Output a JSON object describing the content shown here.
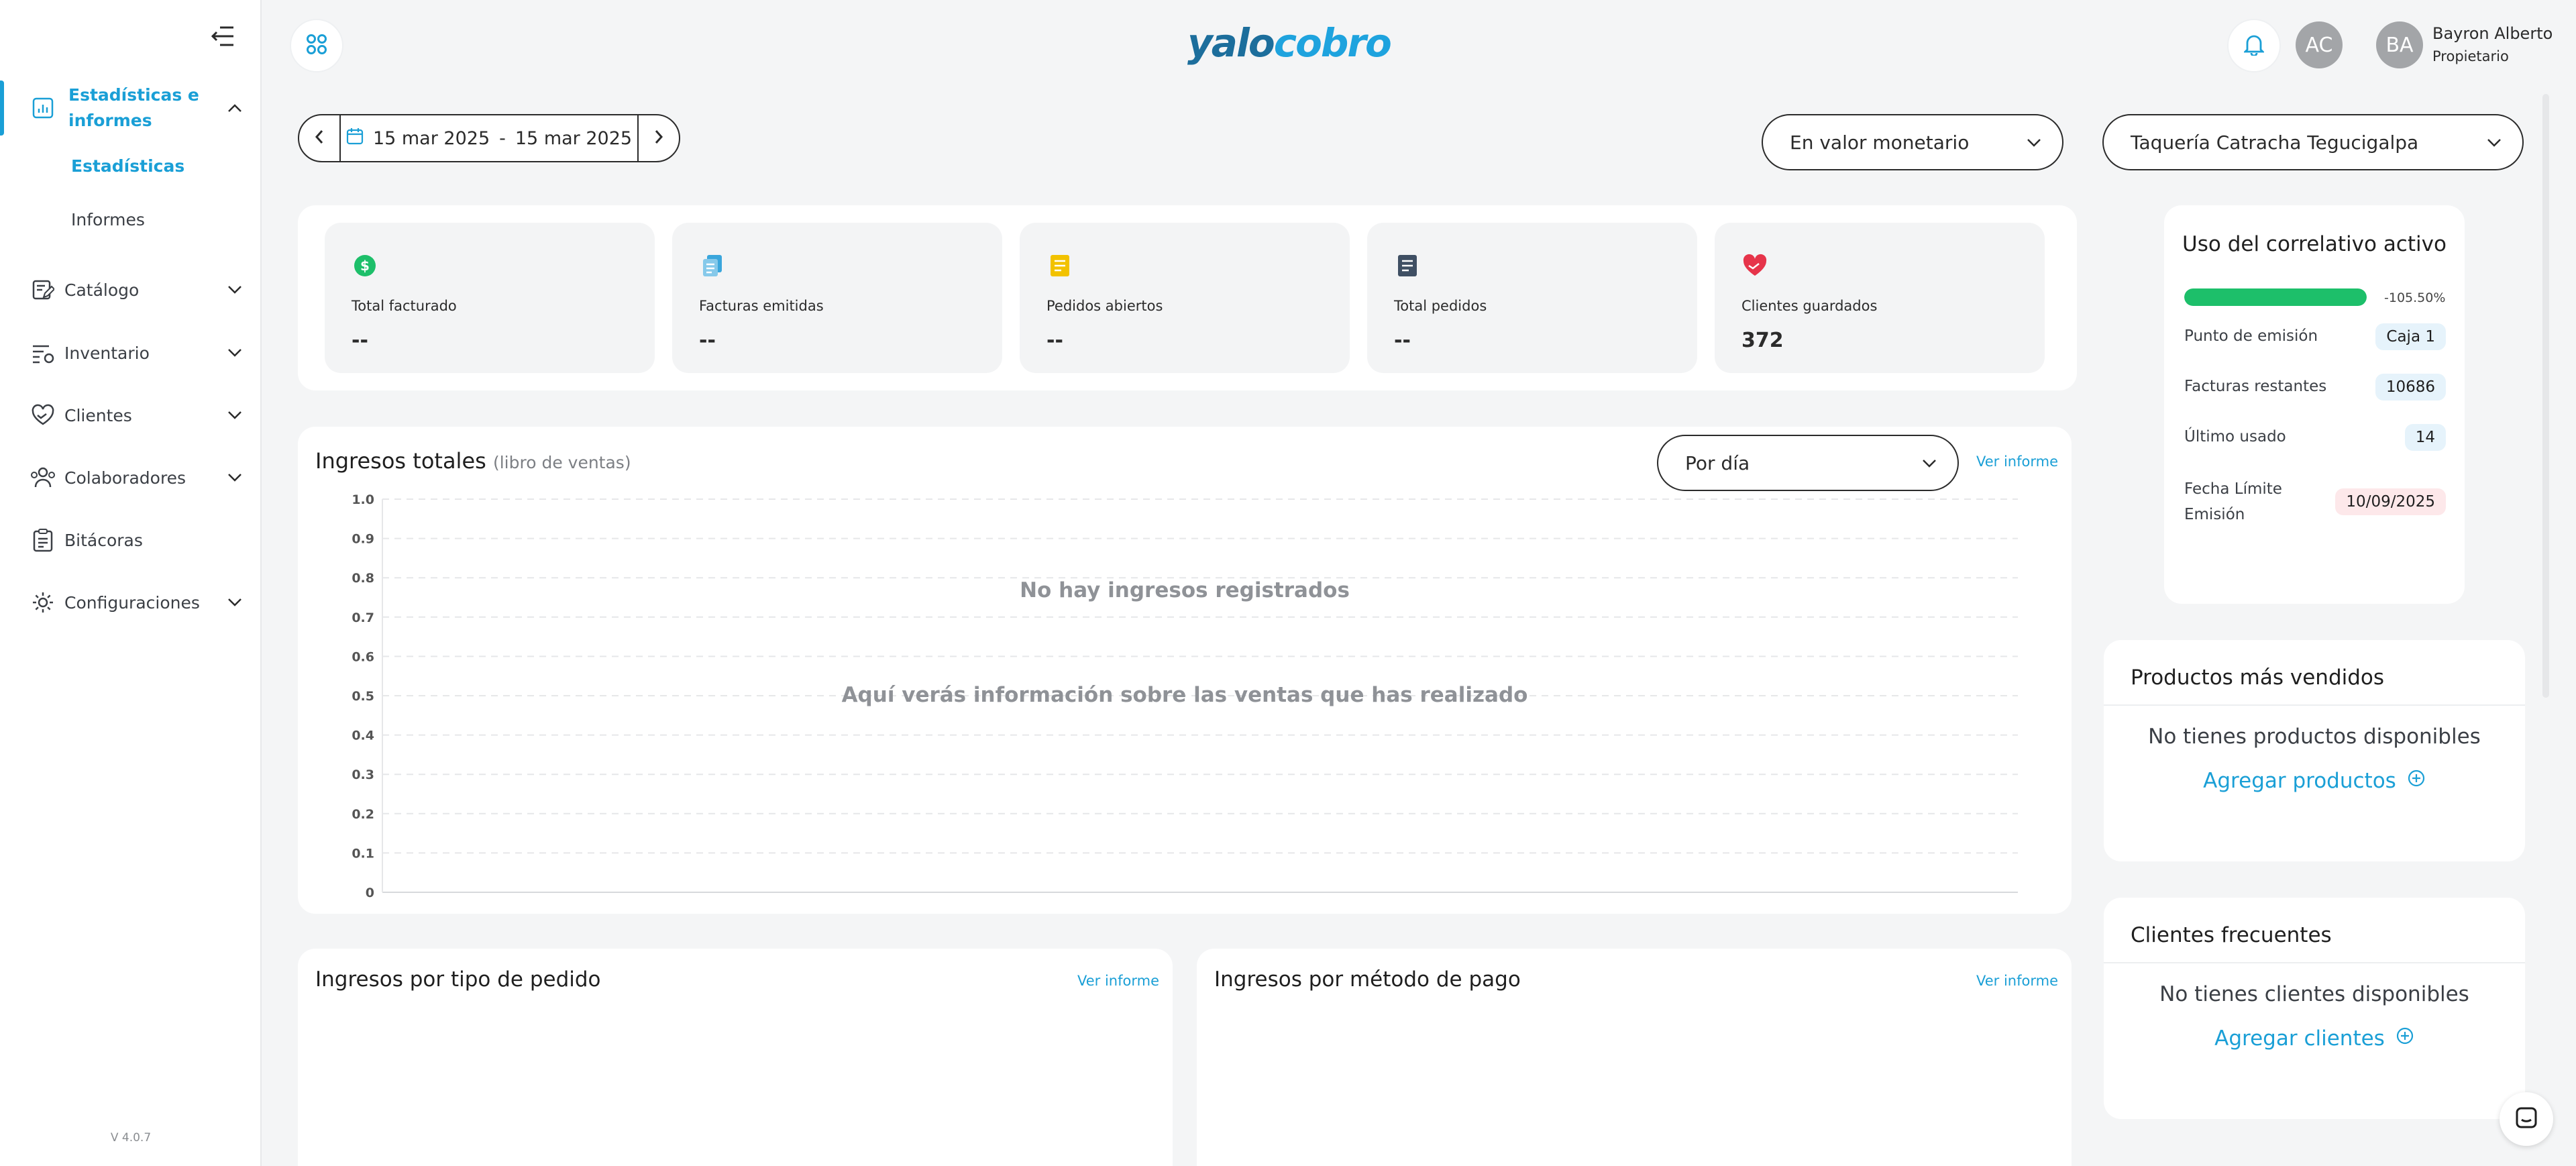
{
  "sidebar": {
    "items": [
      {
        "label": "Estadísticas e informes",
        "icon": "bar-chart-icon"
      },
      {
        "label": "Catálogo",
        "icon": "catalog-edit-icon"
      },
      {
        "label": "Inventario",
        "icon": "inventory-settings-icon"
      },
      {
        "label": "Clientes",
        "icon": "heart-hand-icon"
      },
      {
        "label": "Colaboradores",
        "icon": "users-icon"
      },
      {
        "label": "Bitácoras",
        "icon": "clipboard-icon"
      },
      {
        "label": "Configuraciones",
        "icon": "gear-icon"
      }
    ],
    "subitems": [
      "Estadísticas",
      "Informes"
    ],
    "version": "V 4.0.7"
  },
  "header": {
    "logo_part1": "yalo",
    "logo_part2": "cobro",
    "avatar_initials": "AC",
    "user_initials": "BA",
    "user_name": "Bayron Alberto",
    "user_role": "Propietario"
  },
  "filters": {
    "date_from": "15 mar 2025",
    "date_sep": "-",
    "date_to": "15 mar 2025",
    "value_mode": "En valor monetario",
    "branch": "Taquería Catracha Tegucigalpa"
  },
  "kpis": [
    {
      "label": "Total facturado",
      "value": "--",
      "icon": "dollar-icon",
      "color": "#1dbf6a"
    },
    {
      "label": "Facturas emitidas",
      "value": "--",
      "icon": "invoices-icon",
      "color": "#3aa6dc"
    },
    {
      "label": "Pedidos abiertos",
      "value": "--",
      "icon": "open-orders-icon",
      "color": "#f2c200"
    },
    {
      "label": "Total pedidos",
      "value": "--",
      "icon": "document-icon",
      "color": "#3f4f63"
    },
    {
      "label": "Clientes guardados",
      "value": "372",
      "icon": "heart-icon",
      "color": "#e6344a"
    }
  ],
  "correlativo": {
    "title": "Uso del correlativo activo",
    "progress_fraction": 1.0,
    "progress_text": "-105.50%",
    "rows": [
      {
        "label": "Punto de emisión",
        "value": "Caja 1"
      },
      {
        "label": "Facturas restantes",
        "value": "10686"
      },
      {
        "label": "Último usado",
        "value": "14"
      },
      {
        "label": "Fecha Límite Emisión",
        "value": "10/09/2025"
      }
    ]
  },
  "revenue": {
    "title": "Ingresos totales",
    "subtitle": "(libro de ventas)",
    "period": "Por día",
    "link": "Ver informe",
    "empty_title": "No hay ingresos registrados",
    "empty_desc": "Aquí verás información sobre las ventas que has realizado"
  },
  "chart_data": {
    "type": "line",
    "title": "Ingresos totales",
    "x": [],
    "series": [],
    "y_ticks": [
      "1.0",
      "0.9",
      "0.8",
      "0.7",
      "0.6",
      "0.5",
      "0.4",
      "0.3",
      "0.2",
      "0.1",
      "0"
    ],
    "ylim": [
      0,
      1.0
    ],
    "grid": true
  },
  "bottom": {
    "order_type_title": "Ingresos por tipo de pedido",
    "payment_title": "Ingresos por método de pago",
    "link": "Ver informe"
  },
  "top_products": {
    "title": "Productos más vendidos",
    "empty": "No tienes productos disponibles",
    "add": "Agregar productos"
  },
  "frequent_clients": {
    "title": "Clientes frecuentes",
    "empty": "No tienes clientes disponibles",
    "add": "Agregar clientes"
  },
  "colors": {
    "accent": "#1a9fd6",
    "progress": "#1dbf6a"
  }
}
